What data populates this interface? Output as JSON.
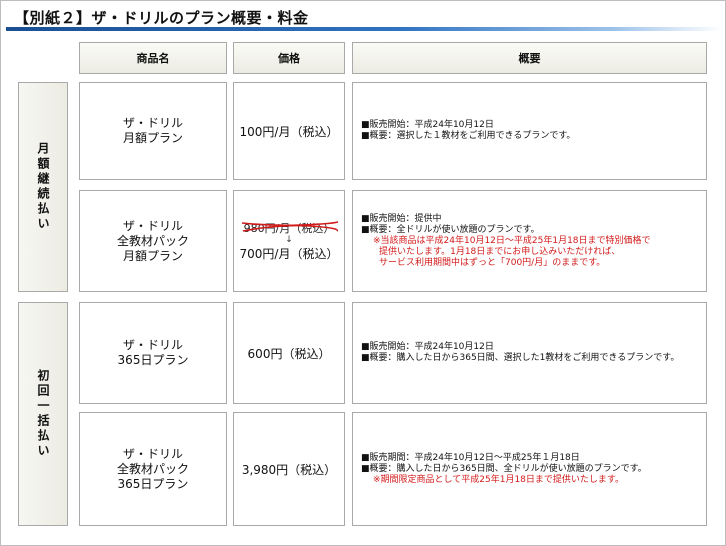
{
  "title": "【別紙２】ザ・ドリルのプラン概要・料金",
  "headers": {
    "name": "商品名",
    "price": "価格",
    "overview": "概要"
  },
  "groups": {
    "monthly": "月額継続払い",
    "onetime": "初回一括払い"
  },
  "rows": [
    {
      "name_line1": "ザ・ドリル",
      "name_line2": "月額プラン",
      "price": "100円/月（税込）",
      "desc": [
        "■販売開始：平成24年10月12日",
        "■概要：選択した１教材をご利用できるプランです。"
      ]
    },
    {
      "name_line1": "ザ・ドリル",
      "name_line2": "全教材パック",
      "name_line3": "月額プラン",
      "old_price": "980円/月（税込）",
      "arrow": "↓",
      "price": "700円/月（税込）",
      "desc": [
        "■販売開始：提供中",
        "■概要：全ドリルが使い放題のプランです。"
      ],
      "desc_red": [
        "※当該商品は平成24年10月12日～平成25年1月18日まで特別価格で",
        "提供いたします。1月18日までにお申し込みいただければ、",
        "サービス利用期間中はずっと「700円/月」のままです。"
      ]
    },
    {
      "name_line1": "ザ・ドリル",
      "name_line2": "365日プラン",
      "price": "600円（税込）",
      "desc": [
        "■販売開始：平成24年10月12日",
        "■概要：購入した日から365日間、選択した1教材をご利用できるプランです。"
      ]
    },
    {
      "name_line1": "ザ・ドリル",
      "name_line2": "全教材パック",
      "name_line3": "365日プラン",
      "price": "3,980円（税込）",
      "desc": [
        "■販売期間：平成24年10月12日～平成25年１月18日",
        "■概要：購入した日から365日間、全ドリルが使い放題のプランです。"
      ],
      "desc_red": [
        "※期間限定商品として平成25年1月18日まで提供いたします。"
      ]
    }
  ]
}
